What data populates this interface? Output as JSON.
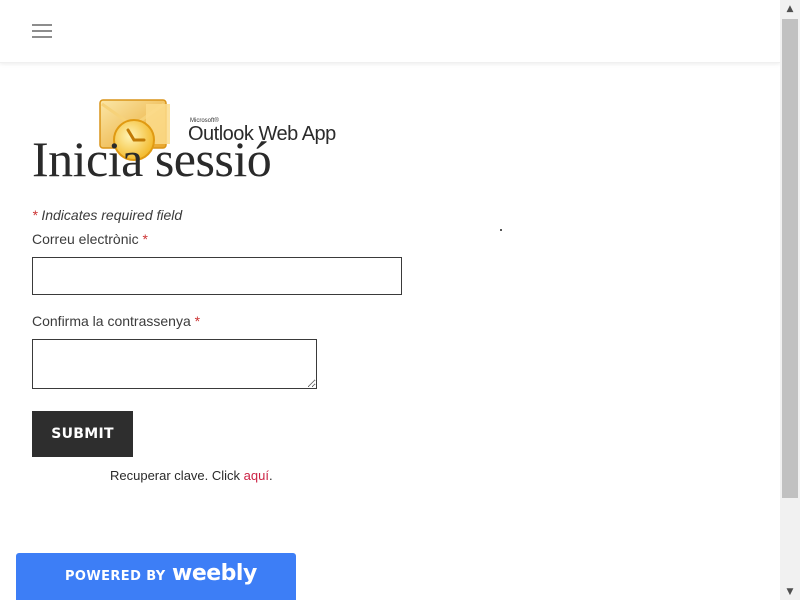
{
  "header": {
    "menu_icon": "hamburger-menu-icon"
  },
  "logo": {
    "small_text": "Microsoft®",
    "text": "Outlook Web App",
    "icon": "outlook-envelope-icon"
  },
  "form": {
    "title": "Inicia sessió",
    "required_star": "*",
    "required_note": "Indicates required field",
    "email_label": "Correu electrònic",
    "email_value": "",
    "password_label": "Confirma la contrassenya",
    "password_value": "",
    "submit_label": "SUBMIT",
    "recover_text": "Recuperar clave. Click",
    "recover_link": "aquí",
    "recover_end": "."
  },
  "badge": {
    "powered": "POWERED BY",
    "brand": "weebly"
  },
  "colors": {
    "accent_red": "#cc2244",
    "button_dark": "#2e2e2e",
    "badge_blue": "#3d7ef6"
  }
}
